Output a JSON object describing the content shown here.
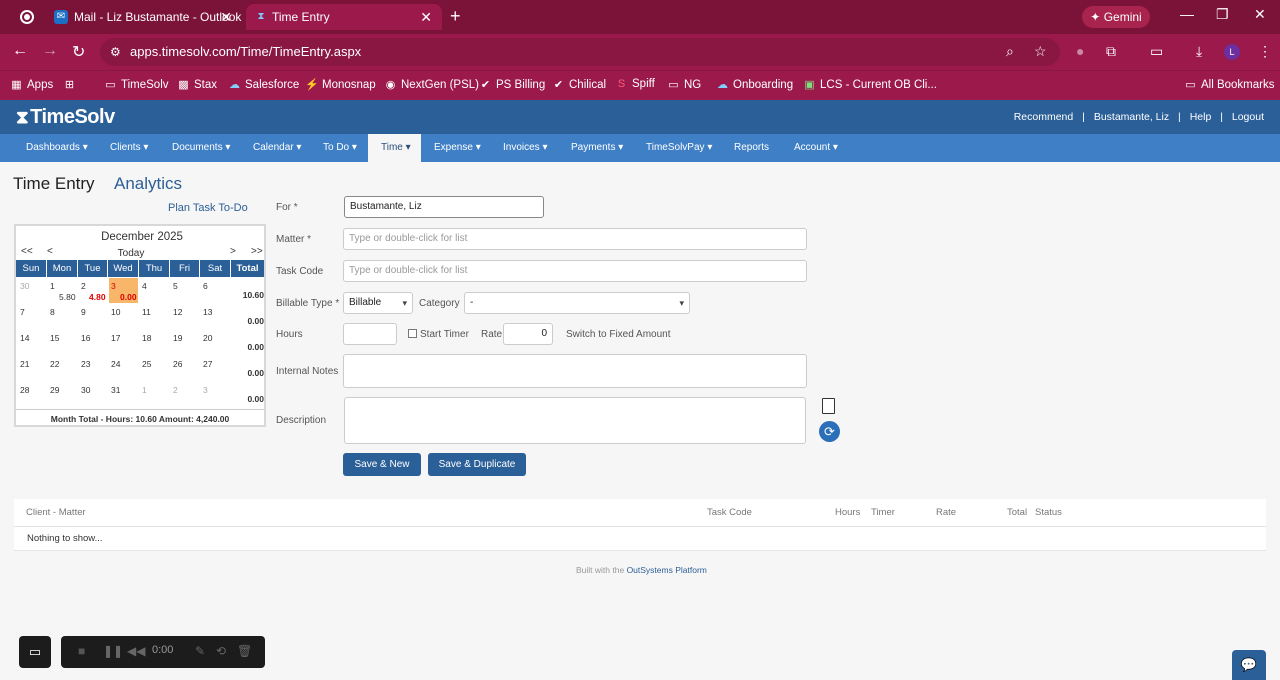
{
  "browser": {
    "tabs": [
      {
        "title": "Mail - Liz Bustamante - Outlook"
      },
      {
        "title": "Time Entry"
      }
    ],
    "gemini_label": "Gemini",
    "url": "apps.timesolv.com/Time/TimeEntry.aspx",
    "profile_initial": "L",
    "bookmarks": [
      "Apps",
      "TimeSolv",
      "Stax",
      "Salesforce",
      "Monosnap",
      "NextGen (PSL)",
      "PS Billing",
      "Chilical",
      "Spiff",
      "NG",
      "Onboarding",
      "LCS - Current OB Cli..."
    ],
    "all_bookmarks": "All Bookmarks"
  },
  "header": {
    "logo": "TimeSolv",
    "links": [
      "Recommend",
      "Bustamante, Liz",
      "Help",
      "Logout"
    ],
    "separator": "|"
  },
  "nav": [
    "Dashboards",
    "Clients",
    "Documents",
    "Calendar",
    "To Do",
    "Time",
    "Expense",
    "Invoices",
    "Payments",
    "TimeSolvPay",
    "Reports",
    "Account"
  ],
  "page": {
    "title": "Time Entry",
    "analytics": "Analytics",
    "plan_link": "Plan Task To-Do"
  },
  "calendar": {
    "month": "December 2025",
    "today": "Today",
    "prev_year": "<<",
    "prev_month": "<",
    "next_month": ">",
    "next_year": ">>",
    "days": [
      "Sun",
      "Mon",
      "Tue",
      "Wed",
      "Thu",
      "Fri",
      "Sat",
      "Total"
    ],
    "weeks": [
      [
        "30",
        "1",
        "2",
        "3",
        "4",
        "5",
        "6"
      ],
      [
        "7",
        "8",
        "9",
        "10",
        "11",
        "12",
        "13"
      ],
      [
        "14",
        "15",
        "16",
        "17",
        "18",
        "19",
        "20"
      ],
      [
        "21",
        "22",
        "23",
        "24",
        "25",
        "26",
        "27"
      ],
      [
        "28",
        "29",
        "30",
        "31",
        "1",
        "2",
        "3"
      ]
    ],
    "hours": {
      "mon1": "5.80",
      "tue2": "4.80",
      "wed3": "0.00"
    },
    "totals": [
      "10.60",
      "0.00",
      "0.00",
      "0.00",
      "0.00"
    ],
    "footer": "Month Total - Hours: 10.60   Amount: 4,240.00"
  },
  "form": {
    "for_label": "For",
    "for_value": "Bustamante, Liz",
    "matter_label": "Matter",
    "matter_placeholder": "Type or double-click for list",
    "task_label": "Task Code",
    "task_placeholder": "Type or double-click for list",
    "billable_label": "Billable Type",
    "billable_value": "Billable",
    "category_label": "Category",
    "category_value": "-",
    "hours_label": "Hours",
    "start_timer": "Start Timer",
    "rate_label": "Rate",
    "rate_value": "0",
    "switch_fixed": "Switch to Fixed Amount",
    "notes_label": "Internal Notes",
    "desc_label": "Description",
    "required": "*",
    "save_new": "Save & New",
    "save_dup": "Save & Duplicate"
  },
  "grid": {
    "columns": [
      "Client - Matter",
      "Task Code",
      "Hours",
      "Timer",
      "Rate",
      "Total",
      "Status"
    ],
    "empty": "Nothing to show..."
  },
  "footer": {
    "prefix": "Built with the ",
    "platform": "OutSystems Platform"
  },
  "recorder": {
    "time": "0:00"
  },
  "colors": {
    "chrome": "#7b1238",
    "brand": "#2a5f98",
    "nav": "#3f7fc6",
    "highlight": "#f7b66a"
  }
}
